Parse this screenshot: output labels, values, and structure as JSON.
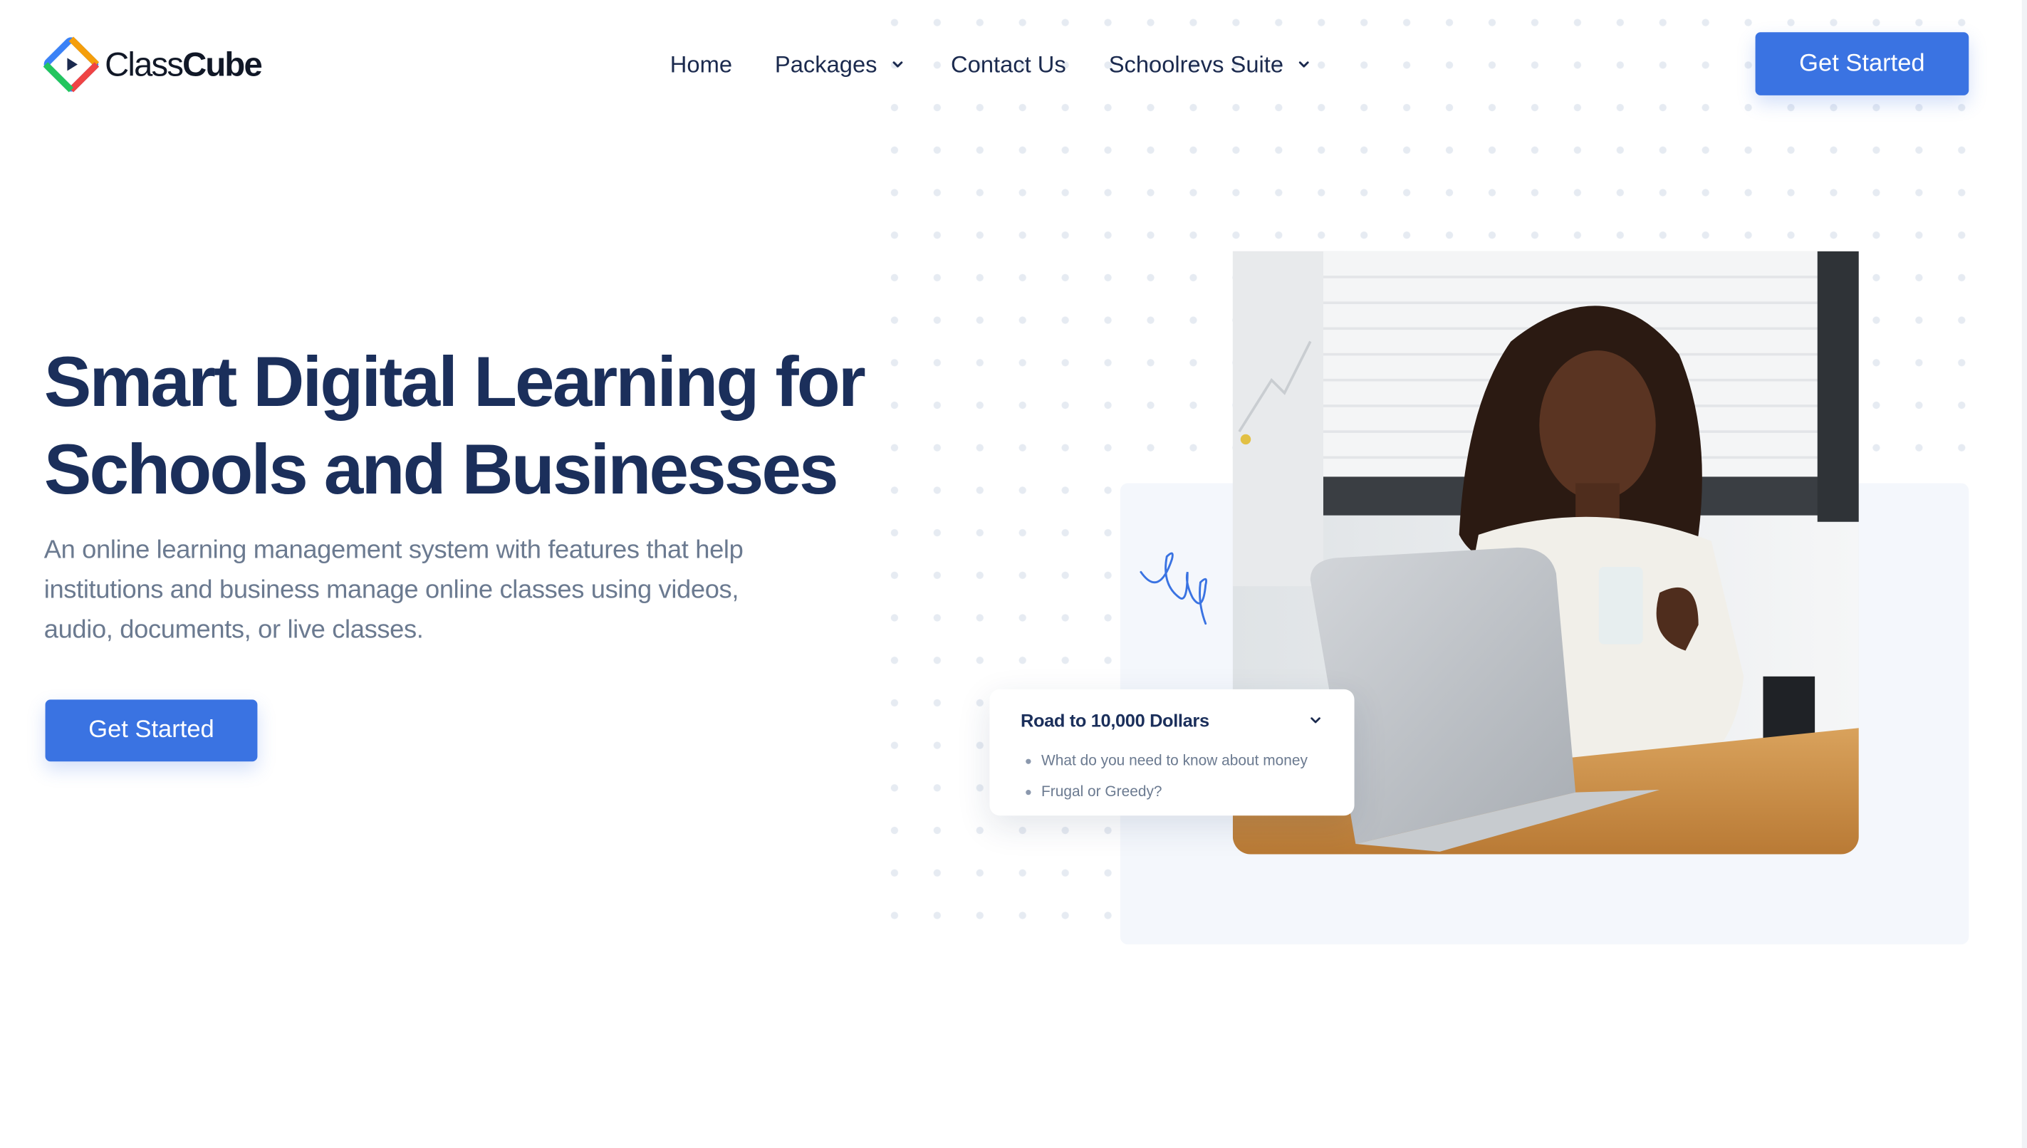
{
  "brand": {
    "logo_part1": "Class",
    "logo_part2": "Cube",
    "colors": {
      "accent": "#3a73e2",
      "heading": "#1b2f5b",
      "muted": "#6b7a90"
    }
  },
  "nav": {
    "items": [
      {
        "label": "Home",
        "has_dropdown": false
      },
      {
        "label": "Packages",
        "has_dropdown": true
      },
      {
        "label": "Contact Us",
        "has_dropdown": false
      },
      {
        "label": "Schoolrevs Suite",
        "has_dropdown": true
      }
    ],
    "cta_label": "Get Started"
  },
  "hero": {
    "title_line1": "Smart Digital Learning for",
    "title_line2": "Schools and Businesses",
    "subtitle": "An online learning management system with features that help institutions and business manage online classes using videos, audio, documents, or live classes.",
    "cta_label": "Get Started"
  },
  "course_card": {
    "title": "Road to 10,000 Dollars",
    "items": [
      "What do you need to know about money",
      "Frugal or Greedy?"
    ]
  },
  "icons": [
    "classcube-logo-icon",
    "chevron-down-icon",
    "squiggle-decoration-icon"
  ]
}
